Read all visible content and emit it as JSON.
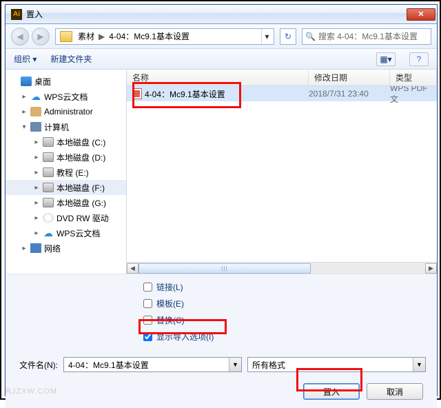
{
  "titlebar": {
    "app_icon": "Ai",
    "title": "置入"
  },
  "nav": {
    "path_parts": [
      "素材",
      "4-04：Mc9.1基本设置"
    ],
    "search_placeholder": "搜索 4-04：Mc9.1基本设置"
  },
  "toolbar": {
    "organize": "组织 ▾",
    "new_folder": "新建文件夹"
  },
  "tree": {
    "items": [
      {
        "level": 1,
        "tw": "",
        "icon": "ico-desktop",
        "label": "桌面"
      },
      {
        "level": 2,
        "tw": "▸",
        "icon": "ico-cloud",
        "label": "WPS云文档",
        "glyph": "☁"
      },
      {
        "level": 2,
        "tw": "▸",
        "icon": "ico-user",
        "label": "Administrator"
      },
      {
        "level": 2,
        "tw": "▾",
        "icon": "ico-pc",
        "label": "计算机"
      },
      {
        "level": 3,
        "tw": "▸",
        "icon": "ico-drive",
        "label": "本地磁盘 (C:)"
      },
      {
        "level": 3,
        "tw": "▸",
        "icon": "ico-drive",
        "label": "本地磁盘 (D:)"
      },
      {
        "level": 3,
        "tw": "▸",
        "icon": "ico-drive",
        "label": "教程 (E:)"
      },
      {
        "level": 3,
        "tw": "▸",
        "icon": "ico-drive",
        "label": "本地磁盘 (F:)",
        "sel": true
      },
      {
        "level": 3,
        "tw": "▸",
        "icon": "ico-drive",
        "label": "本地磁盘 (G:)"
      },
      {
        "level": 3,
        "tw": "▸",
        "icon": "ico-dvd",
        "label": "DVD RW 驱动"
      },
      {
        "level": 3,
        "tw": "▸",
        "icon": "ico-cloud",
        "label": "WPS云文档",
        "glyph": "☁"
      },
      {
        "level": 2,
        "tw": "▸",
        "icon": "ico-net",
        "label": "网络"
      }
    ]
  },
  "columns": {
    "name": "名称",
    "date": "修改日期",
    "type": "类型"
  },
  "files": [
    {
      "name": "4-04：Mc9.1基本设置",
      "date": "2018/7/31 23:40",
      "type": "WPS PDF 文",
      "sel": true
    }
  ],
  "options": {
    "link": "链接(L)",
    "template": "模板(E)",
    "replace": "替换(C)",
    "show_import": "显示导入选项(I)",
    "show_import_checked": true
  },
  "bottom": {
    "filename_label": "文件名(N):",
    "filename_value": "4-04：Mc9.1基本设置",
    "filter_label": "所有格式",
    "place": "置入",
    "cancel": "取消"
  },
  "watermark": "RJZXW.COM"
}
